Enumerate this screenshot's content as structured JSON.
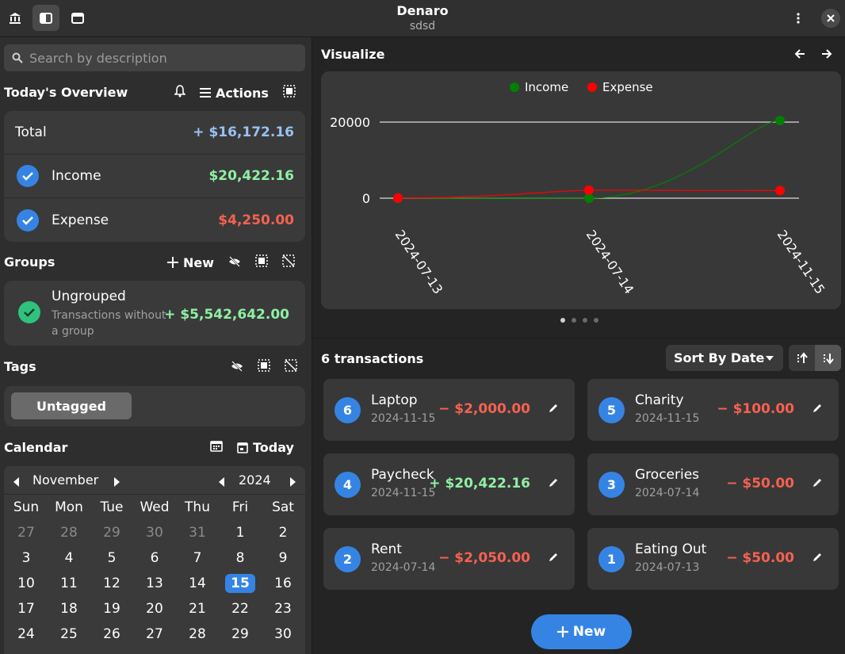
{
  "header": {
    "title": "Denaro",
    "subtitle": "sdsd"
  },
  "search": {
    "placeholder": "Search by description"
  },
  "overview": {
    "title": "Today's Overview",
    "actions_label": "Actions",
    "rows": [
      {
        "label": "Total",
        "amount": "+ $16,172.16"
      },
      {
        "label": "Income",
        "amount": "$20,422.16"
      },
      {
        "label": "Expense",
        "amount": "$4,250.00"
      }
    ]
  },
  "groups": {
    "title": "Groups",
    "new_label": "New",
    "items": [
      {
        "name": "Ungrouped",
        "desc_line1": "Transactions without",
        "desc_line2": "a group",
        "amount": "+ $5,542,642.00"
      }
    ]
  },
  "tags": {
    "title": "Tags",
    "items": [
      "Untagged"
    ]
  },
  "calendar": {
    "title": "Calendar",
    "today_label": "Today",
    "month": "November",
    "year": "2024",
    "weekdays": [
      "Sun",
      "Mon",
      "Tue",
      "Wed",
      "Thu",
      "Fri",
      "Sat"
    ],
    "days": [
      [
        "27",
        "28",
        "29",
        "30",
        "31",
        "1",
        "2"
      ],
      [
        "3",
        "4",
        "5",
        "6",
        "7",
        "8",
        "9"
      ],
      [
        "10",
        "11",
        "12",
        "13",
        "14",
        "15",
        "16"
      ],
      [
        "17",
        "18",
        "19",
        "20",
        "21",
        "22",
        "23"
      ],
      [
        "24",
        "25",
        "26",
        "27",
        "28",
        "29",
        "30"
      ]
    ],
    "selected_day": "15"
  },
  "visualize": {
    "title": "Visualize"
  },
  "chart_data": {
    "type": "line",
    "x": [
      "2024-07-13",
      "2024-07-14",
      "2024-11-15"
    ],
    "series": [
      {
        "name": "Income",
        "color": "#008000",
        "values": [
          0,
          0,
          20422.16
        ]
      },
      {
        "name": "Expense",
        "color": "#ff0000",
        "values": [
          50,
          2100,
          2000
        ]
      }
    ],
    "yticks": [
      "20000",
      "0"
    ],
    "ylim": [
      0,
      20000
    ],
    "legend": "top-center"
  },
  "transactions": {
    "count_label": "6 transactions",
    "sort_label": "Sort By Date",
    "items": [
      {
        "id": "6",
        "name": "Laptop",
        "date": "2024-11-15",
        "amount": "− $2,000.00",
        "type": "expense"
      },
      {
        "id": "5",
        "name": "Charity",
        "date": "2024-11-15",
        "amount": "− $100.00",
        "type": "expense"
      },
      {
        "id": "4",
        "name": "Paycheck",
        "date": "2024-11-15",
        "amount": "+ $20,422.16",
        "type": "income"
      },
      {
        "id": "3",
        "name": "Groceries",
        "date": "2024-07-14",
        "amount": "− $50.00",
        "type": "expense"
      },
      {
        "id": "2",
        "name": "Rent",
        "date": "2024-07-14",
        "amount": "− $2,050.00",
        "type": "expense"
      },
      {
        "id": "1",
        "name": "Eating Out",
        "date": "2024-07-13",
        "amount": "− $50.00",
        "type": "expense"
      }
    ],
    "new_label": "New"
  }
}
